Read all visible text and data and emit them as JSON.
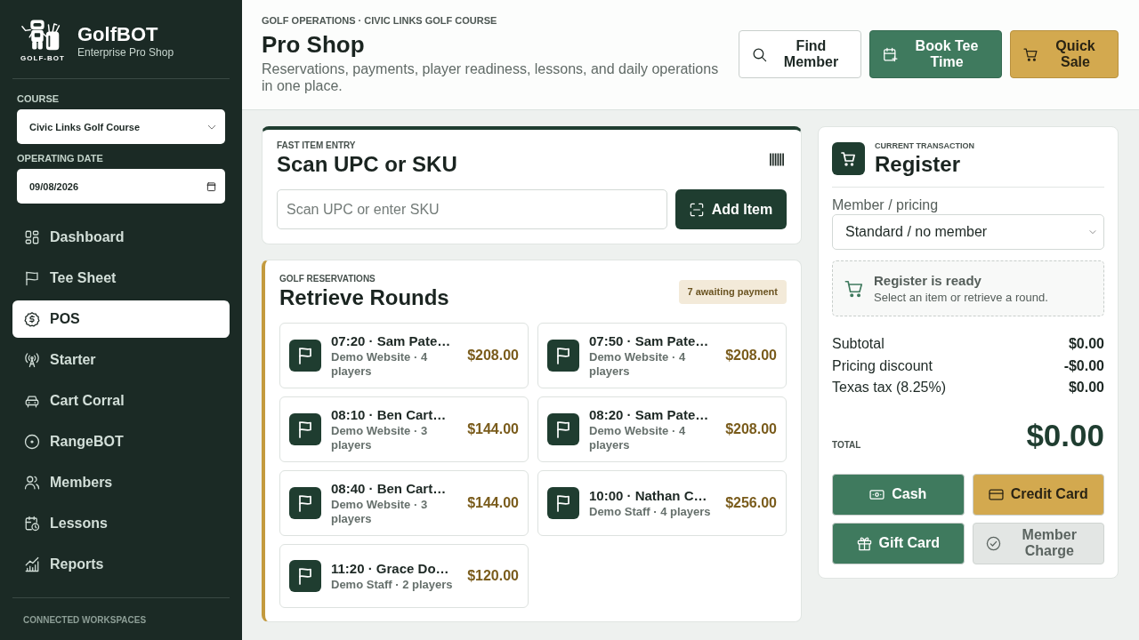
{
  "sidebar": {
    "brand": {
      "logo_caption": "GOLF-BOT",
      "name": "GolfBOT",
      "tagline": "Enterprise Pro Shop"
    },
    "course": {
      "label": "COURSE",
      "value": "Civic Links Golf Course"
    },
    "operating_date": {
      "label": "OPERATING DATE",
      "value": "09/08/2026"
    },
    "nav": [
      {
        "label": "Dashboard",
        "selected": false
      },
      {
        "label": "Tee Sheet",
        "selected": false
      },
      {
        "label": "POS",
        "selected": true
      },
      {
        "label": "Starter",
        "selected": false
      },
      {
        "label": "Cart Corral",
        "selected": false
      },
      {
        "label": "RangeBOT",
        "selected": false
      },
      {
        "label": "Members",
        "selected": false
      },
      {
        "label": "Lessons",
        "selected": false
      },
      {
        "label": "Reports",
        "selected": false
      }
    ],
    "footer_label": "CONNECTED WORKSPACES"
  },
  "header": {
    "breadcrumb": "GOLF OPERATIONS · CIVIC LINKS GOLF COURSE",
    "title": "Pro Shop",
    "description": "Reservations, payments, player readiness, lessons, and daily operations in one place.",
    "actions": [
      {
        "label": "Find Member",
        "kind": "outline"
      },
      {
        "label": "Book Tee Time",
        "kind": "primary"
      },
      {
        "label": "Quick Sale",
        "kind": "accent"
      }
    ]
  },
  "scan_card": {
    "eyebrow": "FAST ITEM ENTRY",
    "title": "Scan UPC or SKU",
    "input": {
      "placeholder": "Scan UPC or enter SKU"
    },
    "button": "Add Item"
  },
  "rounds_card": {
    "eyebrow": "GOLF RESERVATIONS",
    "title": "Retrieve Rounds",
    "badge": "7 awaiting payment",
    "rounds": [
      {
        "title": "07:20 · Sam Pate…",
        "detail": "Demo Website · 4 players",
        "amount": "$208.00"
      },
      {
        "title": "07:50 · Sam Pate…",
        "detail": "Demo Website · 4 players",
        "amount": "$208.00"
      },
      {
        "title": "08:10 · Ben Cart…",
        "detail": "Demo Website · 3 players",
        "amount": "$144.00"
      },
      {
        "title": "08:20 · Sam Pate…",
        "detail": "Demo Website · 4 players",
        "amount": "$208.00"
      },
      {
        "title": "08:40 · Ben Cart…",
        "detail": "Demo Website · 3 players",
        "amount": "$144.00"
      },
      {
        "title": "10:00 · Nathan C…",
        "detail": "Demo Staff · 4 players",
        "amount": "$256.00"
      },
      {
        "title": "11:20 · Grace Do…",
        "detail": "Demo Staff · 2 players",
        "amount": "$120.00"
      }
    ]
  },
  "register": {
    "eyebrow": "CURRENT TRANSACTION",
    "title": "Register",
    "pricing": {
      "label": "Member / pricing",
      "value": "Standard / no member"
    },
    "status": {
      "title": "Register is ready",
      "message": "Select an item or retrieve a round."
    },
    "lines": [
      {
        "label": "Subtotal",
        "value": "$0.00"
      },
      {
        "label": "Pricing discount",
        "value": "-$0.00"
      },
      {
        "label": "Texas tax (8.25%)",
        "value": "$0.00"
      }
    ],
    "total": {
      "label": "TOTAL",
      "value": "$0.00"
    },
    "payments": [
      {
        "label": "Cash",
        "kind": "primary",
        "disabled": false
      },
      {
        "label": "Credit Card",
        "kind": "accent",
        "disabled": false
      },
      {
        "label": "Gift Card",
        "kind": "primary",
        "disabled": false
      },
      {
        "label": "Member Charge",
        "kind": "secondary",
        "disabled": true
      }
    ]
  }
}
